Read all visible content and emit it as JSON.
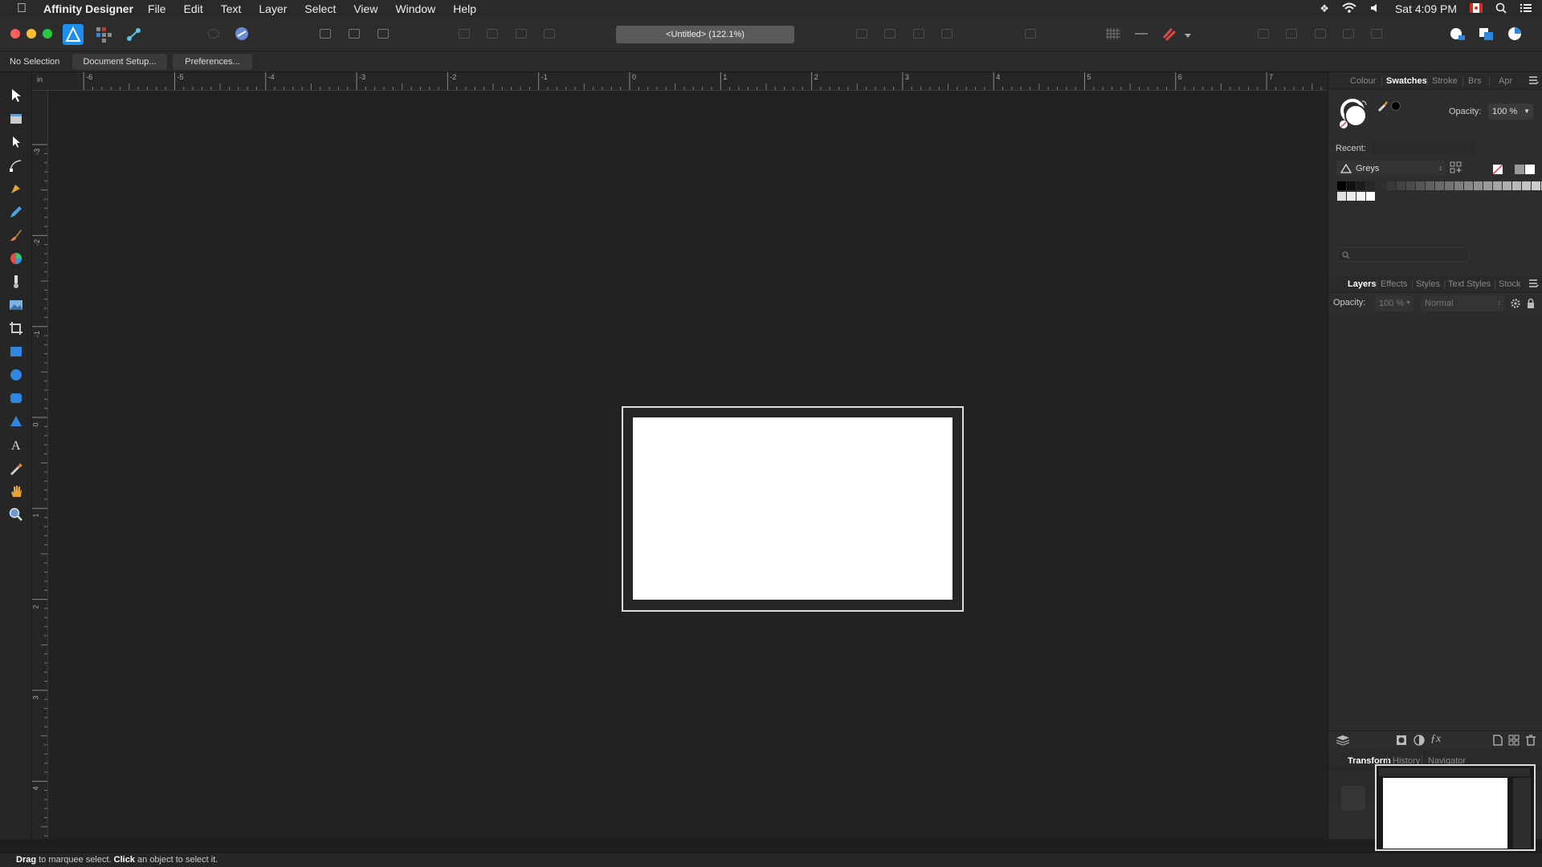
{
  "menubar": {
    "app_name": "Affinity Designer",
    "menus": [
      "File",
      "Edit",
      "Text",
      "Layer",
      "Select",
      "View",
      "Window",
      "Help"
    ],
    "clock": "Sat 4:09 PM"
  },
  "toolbar": {
    "document_title": "<Untitled> (122.1%)"
  },
  "context_bar": {
    "selection_label": "No Selection",
    "document_setup": "Document Setup...",
    "preferences": "Preferences..."
  },
  "rulers": {
    "unit": "in",
    "top_ticks": [
      "-6",
      "-5",
      "-4",
      "-3",
      "-2",
      "-1",
      "0",
      "1",
      "2",
      "3",
      "4",
      "5",
      "6",
      "7"
    ],
    "left_ticks": [
      "-3",
      "-2",
      "-1",
      "0",
      "1",
      "2",
      "3",
      "4"
    ]
  },
  "colour_panel": {
    "tabs": [
      "Colour",
      "Swatches",
      "Stroke",
      "Brs",
      "Apr"
    ],
    "active_tab": "Swatches",
    "opacity_label": "Opacity:",
    "opacity_value": "100 %",
    "recent_label": "Recent:",
    "palette_name": "Greys",
    "grey_swatches": [
      "#000000",
      "#111111",
      "#1c1c1c",
      "#262626",
      "#2f2f2f",
      "#383838",
      "#424242",
      "#4b4b4b",
      "#555555",
      "#5f5f5f",
      "#696969",
      "#737373",
      "#7d7d7d",
      "#878787",
      "#919191",
      "#9b9b9b",
      "#a5a5a5",
      "#afafaf",
      "#b9b9b9",
      "#c3c3c3",
      "#cdcdcd",
      "#d7d7d7",
      "#e1e1e1",
      "#ebebeb",
      "#f5f5f5",
      "#ffffff"
    ]
  },
  "layers_panel": {
    "tabs": [
      "Layers",
      "Effects",
      "Styles",
      "Text Styles",
      "Stock"
    ],
    "active_tab": "Layers",
    "opacity_label": "Opacity:",
    "opacity_value": "100 %",
    "blend_mode": "Normal"
  },
  "bottom_panel": {
    "tabs": [
      "Transform",
      "History",
      "Navigator"
    ],
    "active_tab": "Transform"
  },
  "status": {
    "drag_bold": "Drag",
    "drag_text": " to marquee select. ",
    "click_bold": "Click",
    "click_text": " an object to select it."
  },
  "colors": {
    "accent_blue": "#1f8ef1",
    "ui_dark": "#2d2d2d",
    "canvas": "#222222"
  }
}
